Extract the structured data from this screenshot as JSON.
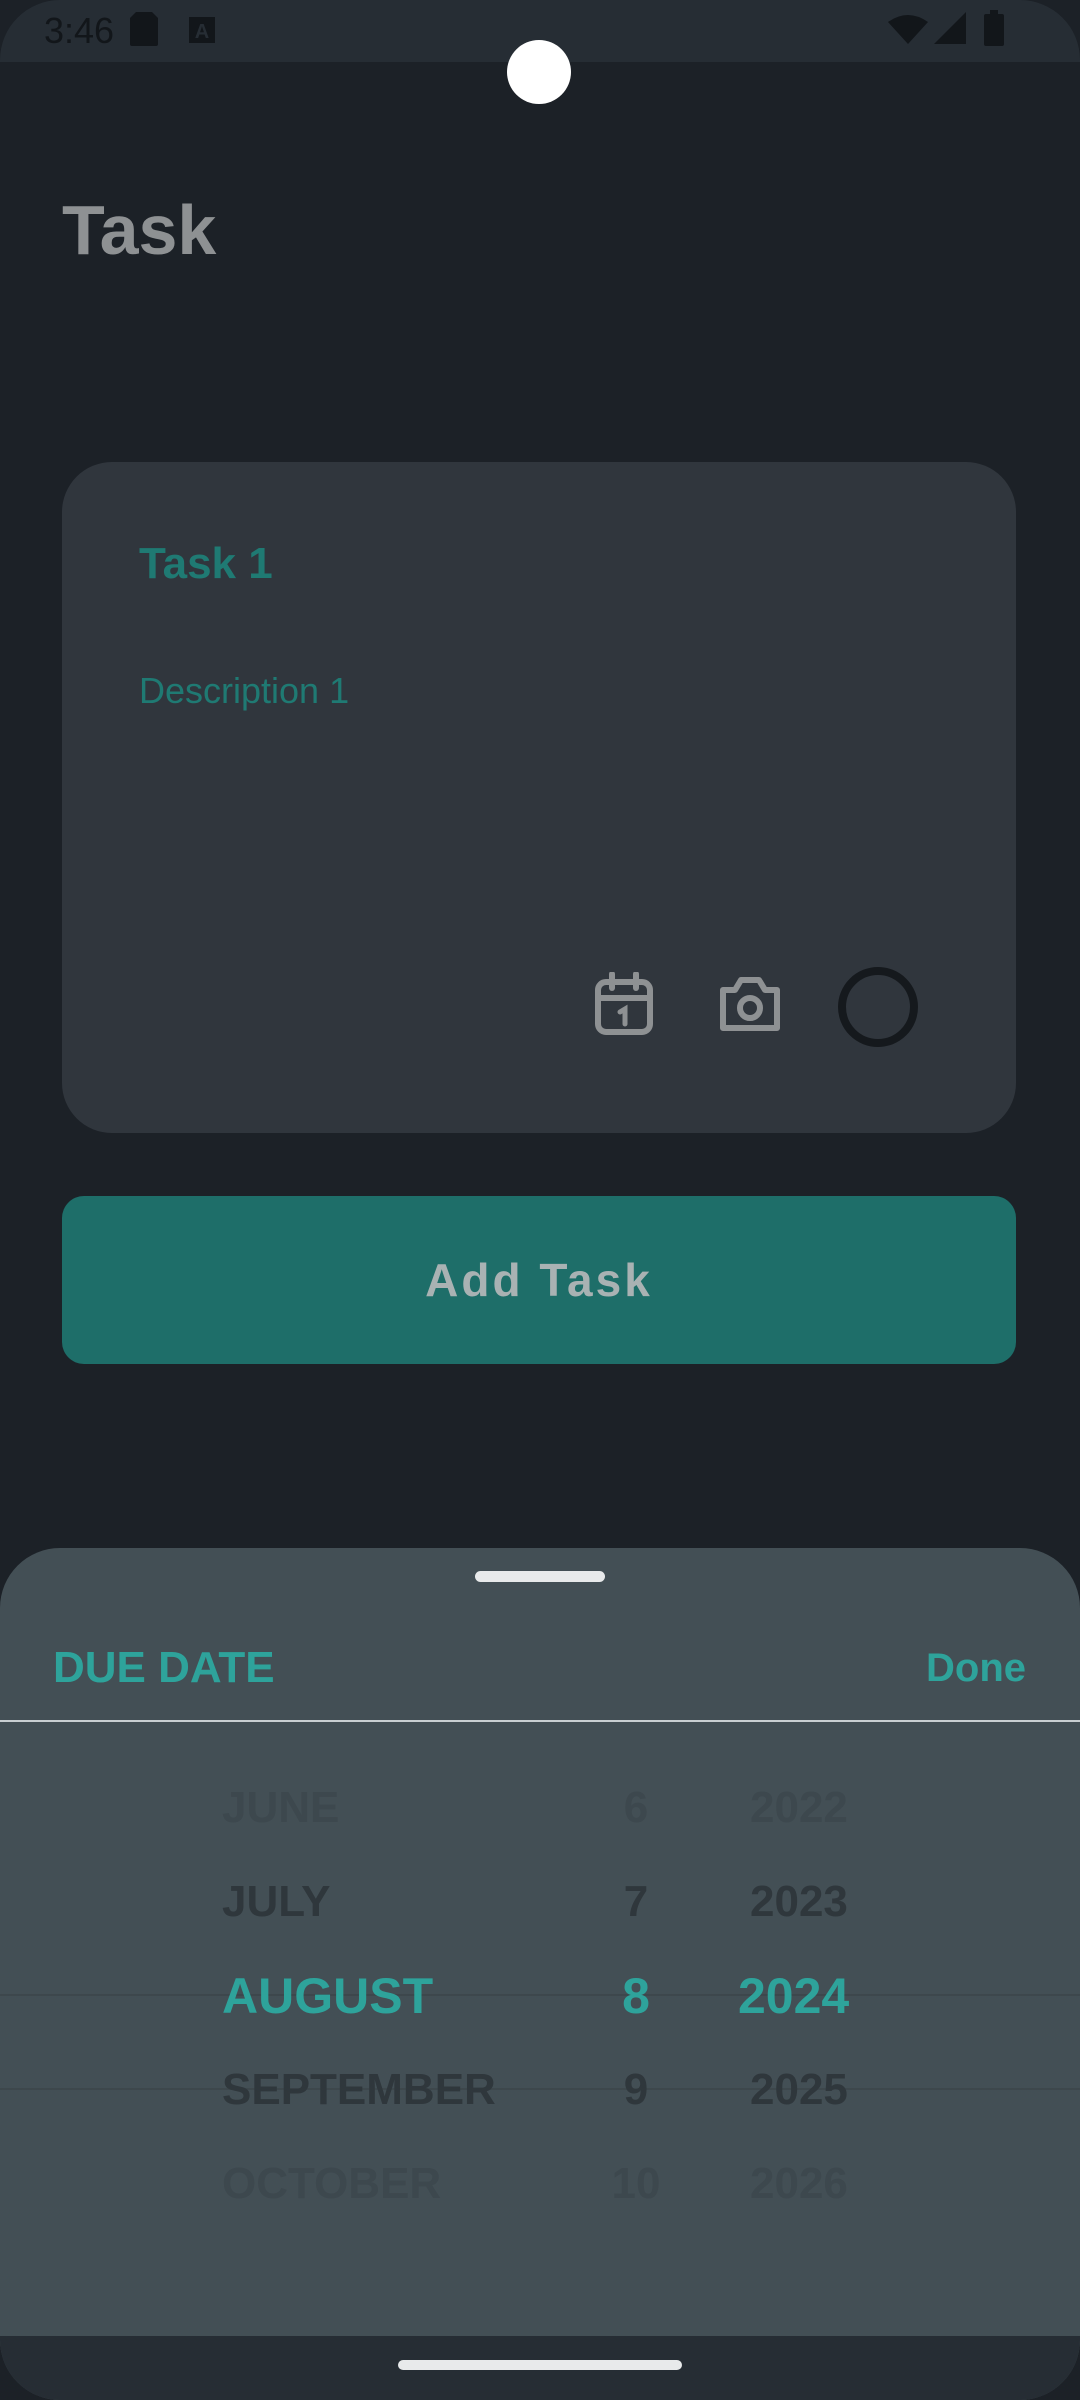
{
  "status_bar": {
    "time": "3:46",
    "left_icons": [
      "sd-card-icon",
      "a-box-icon"
    ],
    "right_icons": [
      "wifi-icon",
      "signal-icon",
      "battery-icon"
    ]
  },
  "header": {
    "title": "Task"
  },
  "task_card": {
    "title": "Task 1",
    "description": "Description 1",
    "icons": [
      "calendar-icon",
      "camera-icon",
      "complete-toggle"
    ]
  },
  "add_button": {
    "label": "Add Task"
  },
  "bottom_sheet": {
    "title": "DUE DATE",
    "done_label": "Done",
    "months": [
      "JUNE",
      "JULY",
      "AUGUST",
      "SEPTEMBER",
      "OCTOBER"
    ],
    "days": [
      "6",
      "7",
      "8",
      "9",
      "10"
    ],
    "years": [
      "2022",
      "2023",
      "2024",
      "2025",
      "2026"
    ],
    "selected": {
      "month": "AUGUST",
      "day": "8",
      "year": "2024"
    }
  },
  "colors": {
    "background": "#1c2127",
    "card": "#30363d",
    "accent": "#2ea39b",
    "button": "#1e6e69",
    "sheet": "#434f55"
  }
}
